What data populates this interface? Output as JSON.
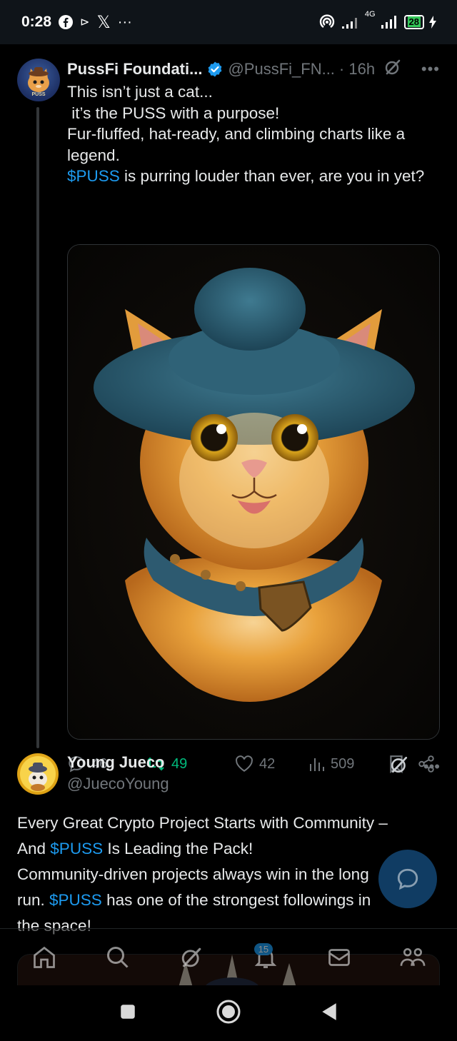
{
  "status_bar": {
    "time": "0:28",
    "network": "4G",
    "battery": "28",
    "x_logo": "𝕏",
    "more": "···",
    "play_icon": "⊳"
  },
  "tweet1": {
    "author_name": "PussFi Foundati...",
    "verified": true,
    "handle": "@PussFi_FN...",
    "time": "· 16h",
    "avatar_text": "PUSS",
    "text_lines": [
      "This isn’t just a cat...",
      " it’s the PUSS with a purpose!",
      "Fur-fluffed, hat-ready, and climbing charts like a",
      "legend."
    ],
    "cashtag": "$PUSS",
    "last_line_rest": " is purring louder than ever, are you in yet?",
    "image_alt": "Orange fluffy kitten wearing a blue felt hat and blue collar with a badge",
    "stats": {
      "replies": "46",
      "reposts": "49",
      "likes": "42",
      "views": "509"
    }
  },
  "tweet2": {
    "author_name": "Young Jueco",
    "handle": "@JuecoYoung",
    "line1": "Every Great Crypto Project Starts with Community –",
    "line2_pre": "And ",
    "line2_tag": "$PUSS",
    "line2_post": " Is Leading the Pack!",
    "line3": "Community-driven projects always win in the long",
    "line4_pre": "run. ",
    "line4_tag": "$PUSS",
    "line4_post": " has one of the strongest followings in",
    "line5": "the space!"
  },
  "bottom_nav": {
    "notifications_badge": "15",
    "items": [
      "home",
      "search",
      "grok",
      "notifications",
      "messages",
      "communities"
    ]
  },
  "colors": {
    "accent": "#1d9bf0",
    "repost": "#00ba7c",
    "muted": "#71767b",
    "background": "#000000"
  }
}
